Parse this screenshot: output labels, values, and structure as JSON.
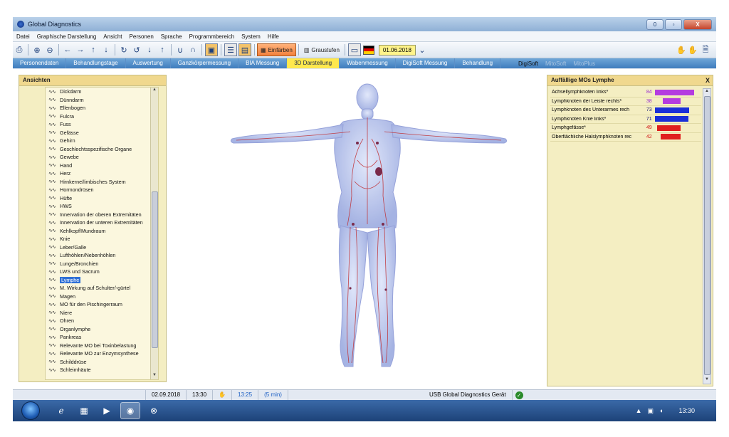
{
  "window": {
    "title": "Global Diagnostics",
    "min": "0",
    "max": "▫",
    "close": "X"
  },
  "menu": [
    "Datei",
    "Graphische Darstellung",
    "Ansicht",
    "Personen",
    "Sprache",
    "Programmbereich",
    "System",
    "Hilfe"
  ],
  "toolbar": {
    "einfaerben_label": "Einfärben",
    "graustufen_label": "Graustufen",
    "date": "01.06.2018"
  },
  "tabs": [
    "Personendaten",
    "Behandlungstage",
    "Auswertung",
    "Ganzkörpermessung",
    "BIA Messung",
    "3D Darstellung",
    "Wabenmessung",
    "DigiSoft Messung",
    "Behandlung"
  ],
  "tabs_active_index": 5,
  "tabs_extra": [
    "DigiSoft",
    "MitoSoft",
    "MitoPlus"
  ],
  "left_panel": {
    "title": "Ansichten",
    "items": [
      "Dickdarm",
      "Dünndarm",
      "Ellenbogen",
      "Fulcra",
      "Fuss",
      "Gefässe",
      "Gehirn",
      "Geschlechtsspezifische Organe",
      "Gewebe",
      "Hand",
      "Herz",
      "Hirnkerne/limbisches System",
      "Hormondrüsen",
      "Hüfte",
      "HWS",
      "Innervation der oberen Extremitäten",
      "Innervation der unteren Extremitäten",
      "Kehlkopf/Mundraum",
      "Knie",
      "Leber/Galle",
      "Lufthöhlen/Nebenhöhlen",
      "Lunge/Bronchien",
      "LWS und Sacrum",
      "Lymphe",
      "M. Wirkung auf Schulter/-gürtel",
      "Magen",
      "MO für den Pischingerraum",
      "Niere",
      "Ohren",
      "Organlymphe",
      "Pankreas",
      "Relevante MO bei Toxinbelastung",
      "Relevante MO zur Enzymsynthese",
      "Schilddrüse",
      "Schleimhäute"
    ],
    "selected": "Lymphe"
  },
  "right_panel": {
    "title": "Auffällige MOs Lymphe",
    "close": "X",
    "rows": [
      {
        "name": "Achsellymphknoten links*",
        "value": "84",
        "color": "#b43ce0"
      },
      {
        "name": "Lymphknoten der Leiste rechts*",
        "value": "38",
        "color": "#b43ce0"
      },
      {
        "name": "Lymphknoten des Unterarmes rech",
        "value": "73",
        "color": "#1a2fd8"
      },
      {
        "name": "Lymphknoten Knie links*",
        "value": "71",
        "color": "#1a2fd8"
      },
      {
        "name": "Lymphgefässe*",
        "value": "49",
        "color": "#e01e1e"
      },
      {
        "name": "Oberflächliche Halslymphknoten rec",
        "value": "42",
        "color": "#e01e1e"
      }
    ]
  },
  "status": {
    "date": "02.09.2018",
    "time1": "13:30",
    "time2": "13:25",
    "duration": "(5 min)",
    "device": "USB Global Diagnostics Gerät"
  },
  "taskbar": {
    "clock": "13:30"
  }
}
